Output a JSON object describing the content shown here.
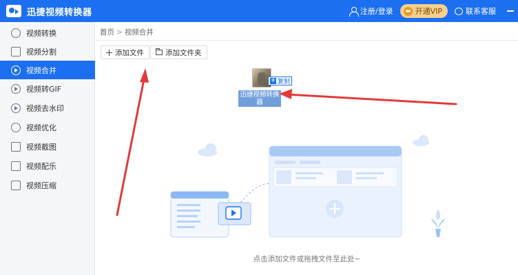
{
  "app": {
    "title": "迅捷视频转换器",
    "login_label": "注册/登录",
    "vip_label": "开通VIP",
    "service_label": "联系客服",
    "accent": "#1c6ff0"
  },
  "sidebar": {
    "items": [
      {
        "label": "视频转换",
        "icon": "video-convert-icon"
      },
      {
        "label": "视频分割",
        "icon": "split-icon"
      },
      {
        "label": "视频合并",
        "icon": "merge-icon",
        "active": true
      },
      {
        "label": "视频转GIF",
        "icon": "gif-icon"
      },
      {
        "label": "视频去水印",
        "icon": "watermark-icon"
      },
      {
        "label": "视频优化",
        "icon": "optimize-icon"
      },
      {
        "label": "视频截图",
        "icon": "screenshot-icon"
      },
      {
        "label": "视频配乐",
        "icon": "music-icon"
      },
      {
        "label": "视频压缩",
        "icon": "compress-icon"
      }
    ]
  },
  "main": {
    "breadcrumb": {
      "home": "首页",
      "sep": ">",
      "current": "视频合并"
    },
    "add_file_label": "添加文件",
    "add_folder_label": "添加文件夹",
    "drag": {
      "copy_label": "复制",
      "file_name": "迅捷视频转换器"
    },
    "empty_hint": "点击添加文件或拖拽文件至此处~"
  }
}
